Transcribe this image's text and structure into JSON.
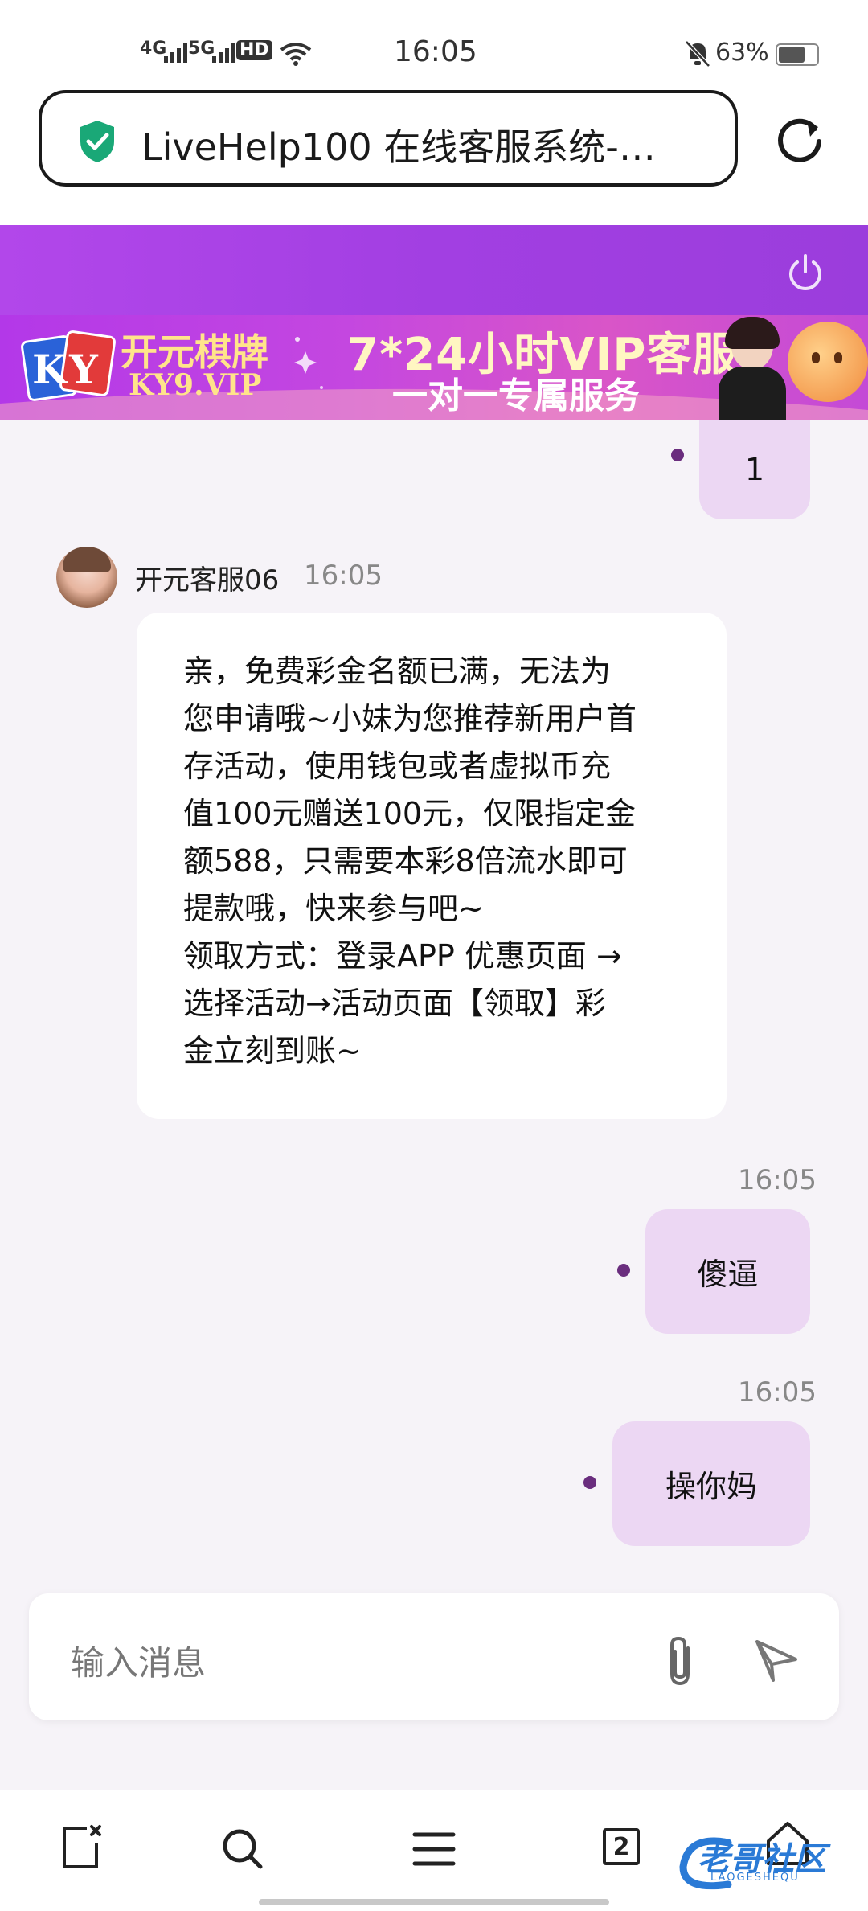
{
  "status_bar": {
    "net1": "4G",
    "net2": "5G",
    "hd": "HD",
    "time": "16:05",
    "battery_pct": "63%",
    "battery_level": 0.63
  },
  "browser": {
    "url_title": "LiveHelp100 在线客服系统-…",
    "secure_icon": "shield-check-icon",
    "reload_icon": "reload-icon"
  },
  "header": {
    "power_icon": "power-icon"
  },
  "banner": {
    "logo_text": "KY",
    "brand_cn": "开元棋牌",
    "brand_url": "KY9.VIP",
    "line1": "7*24小时VIP客服",
    "line2": "一对一专属服务"
  },
  "messages": {
    "out_0": {
      "text": "1"
    },
    "agent": {
      "name": "开元客服06",
      "time": "16:05",
      "text": "亲，免费彩金名额已满，无法为\n您申请哦~小妹为您推荐新用户首\n存活动，使用钱包或者虚拟币充\n值100元赠送100元，仅限指定金\n额588，只需要本彩8倍流水即可\n提款哦，快来参与吧~\n领取方式：登录APP 优惠页面 →\n选择活动→活动页面【领取】彩\n金立刻到账~"
    },
    "out_1": {
      "time": "16:05",
      "text": "傻逼"
    },
    "out_2": {
      "time": "16:05",
      "text": "操你妈"
    }
  },
  "composer": {
    "placeholder": "输入消息",
    "attach_icon": "paperclip-icon",
    "send_icon": "send-icon"
  },
  "bottom_nav": {
    "tab_count": "2",
    "watermark": "老哥社区",
    "watermark_sub": "LAOGESHEQU"
  },
  "colors": {
    "header": "#a23fe2",
    "outgoing_bubble": "#ecd7f3",
    "incoming_bubble": "#ffffff",
    "background": "#f6f3f8",
    "secure_green": "#1aa877"
  }
}
